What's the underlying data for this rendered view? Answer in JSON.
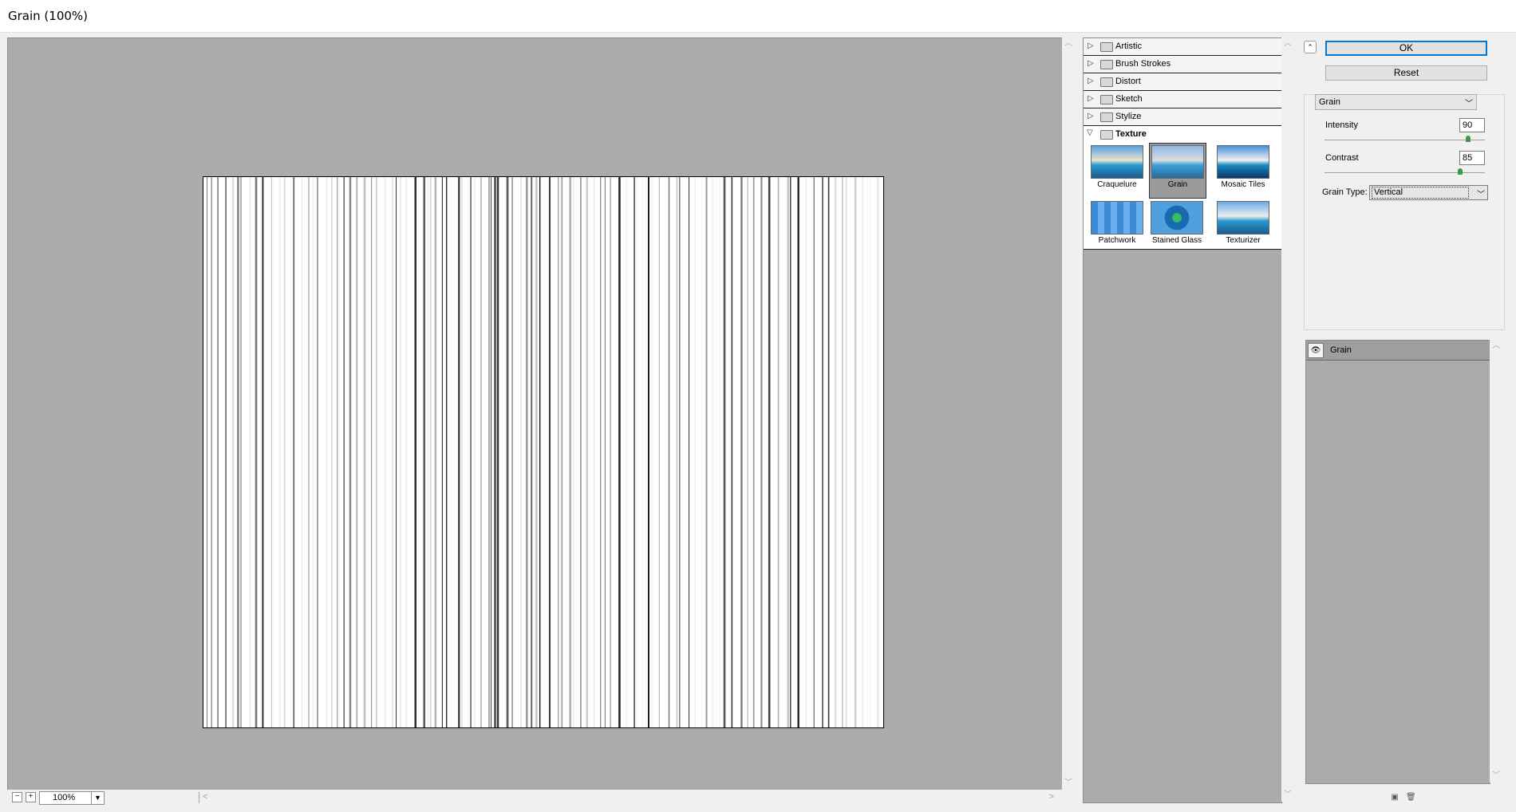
{
  "window": {
    "title": "Grain (100%)"
  },
  "preview": {
    "zoom": "100%"
  },
  "filter_categories": [
    {
      "label": "Artistic"
    },
    {
      "label": "Brush Strokes"
    },
    {
      "label": "Distort"
    },
    {
      "label": "Sketch"
    },
    {
      "label": "Stylize"
    },
    {
      "label": "Texture"
    }
  ],
  "texture_filters": [
    {
      "label": "Craquelure"
    },
    {
      "label": "Grain",
      "selected": true
    },
    {
      "label": "Mosaic Tiles"
    },
    {
      "label": "Patchwork"
    },
    {
      "label": "Stained Glass"
    },
    {
      "label": "Texturizer"
    }
  ],
  "buttons": {
    "ok": "OK",
    "reset": "Reset"
  },
  "settings": {
    "filter": "Grain",
    "intensity_label": "Intensity",
    "intensity": "90",
    "contrast_label": "Contrast",
    "contrast": "85",
    "grain_type_label": "Grain Type:",
    "grain_type": "Vertical"
  },
  "layers": [
    {
      "name": "Grain"
    }
  ]
}
